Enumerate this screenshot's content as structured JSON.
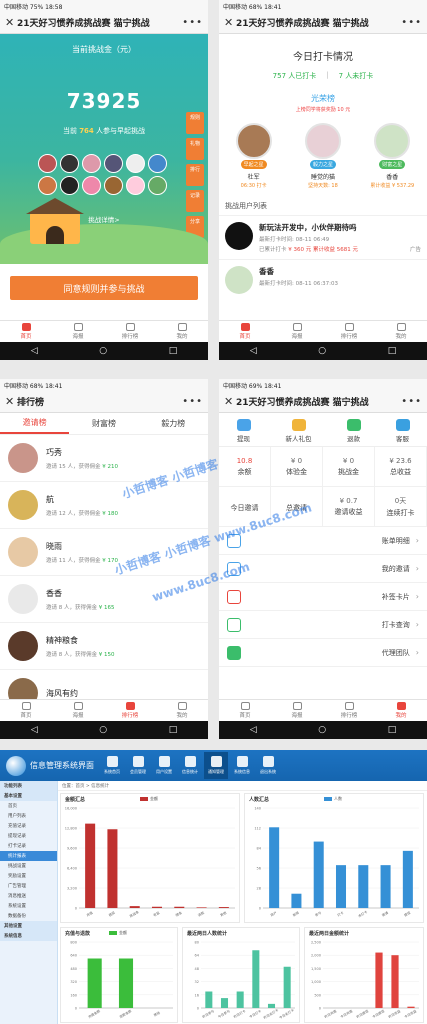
{
  "status": {
    "p1": "中国移动 75% 18:58",
    "p2": "中国移动 68% 18:41",
    "p3": "中国移动 68% 18:41",
    "p4": "中国移动 69% 18:41"
  },
  "p1": {
    "title": "21天好习惯养成挑战赛 猫宁挑战",
    "label": "当前挑战金（元）",
    "amount": "73925",
    "count_pre": "当前",
    "count_num": "764",
    "count_post": "人参与早起挑战",
    "link": "挑战详情>",
    "join": "同意规则并参与挑战",
    "side": [
      "规则",
      "礼物",
      "排行",
      "记录",
      "分享"
    ]
  },
  "p2": {
    "title": "21天好习惯养成挑战赛 猫宁挑战",
    "heading": "今日打卡情况",
    "done": "757 人已打卡",
    "undone": "7 人未打卡",
    "rank_title": "光荣榜",
    "rank_sub": "上榜同学将获奖励 10 元",
    "tops": [
      {
        "tag": "早起之星",
        "name": "杜军",
        "sub": "06:30 打卡"
      },
      {
        "tag": "毅力之星",
        "name": "睡觉的猫",
        "sub": "坚持天数: 18"
      },
      {
        "tag": "财富之星",
        "name": "香香",
        "sub": "累计收益 ¥ 537.29"
      }
    ],
    "list_title": "挑战用户列表",
    "users": [
      {
        "name": "新玩法开发中，小伙伴期待吗",
        "l1": "最新打卡时间: 08-11 06:49",
        "l2a": "已累计打卡",
        "l2b": "¥ 360 元 累计收益",
        "l2c": "5681 元",
        "ad": "广告"
      },
      {
        "name": "香香",
        "l1": "最新打卡时间: 08-11 06:37:03",
        "l2a": "",
        "l2b": "",
        "l2c": "",
        "ad": ""
      }
    ]
  },
  "p3": {
    "title": "排行榜",
    "tabs": [
      "邀请榜",
      "财富榜",
      "毅力榜"
    ],
    "rows": [
      {
        "name": "巧秀",
        "pre": "邀请 15 人，获得佣金",
        "amt": "¥ 210"
      },
      {
        "name": "航",
        "pre": "邀请 12 人，获得佣金",
        "amt": "¥ 180"
      },
      {
        "name": "晓雨",
        "pre": "邀请 11 人，获得佣金",
        "amt": "¥ 170"
      },
      {
        "name": "香香",
        "pre": "邀请 8 人，获得佣金",
        "amt": "¥ 165"
      },
      {
        "name": "精神粮食",
        "pre": "邀请 8 人，获得佣金",
        "amt": "¥ 150"
      },
      {
        "name": "海风有约",
        "pre": "",
        "amt": ""
      }
    ]
  },
  "p4": {
    "title": "21天好习惯养成挑战赛 猫宁挑战",
    "icons": [
      "提现",
      "新人礼包",
      "退款",
      "客服"
    ],
    "cells": [
      {
        "v": "10.8",
        "l": "余额"
      },
      {
        "v": "¥ 0",
        "l": "体验金"
      },
      {
        "v": "¥ 0",
        "l": "挑战金"
      },
      {
        "v": "¥ 23.6",
        "l": "总收益"
      },
      {
        "v": "",
        "l": "今日邀请"
      },
      {
        "v": "",
        "l": "总邀请"
      },
      {
        "v": "¥ 0.7",
        "l": "邀请收益"
      },
      {
        "v": "0天",
        "l": "连续打卡"
      }
    ],
    "menu": [
      "账单明细",
      "我的邀请",
      "补签卡片",
      "打卡查询",
      "代理团队"
    ]
  },
  "tabbar": [
    "首页",
    "海报",
    "排行榜",
    "我的"
  ],
  "watermark": [
    "小哲博客 小哲博客",
    "小哲博客 小哲博客 www.8uc8.com",
    "www.8uc8.com"
  ],
  "admin": {
    "title": "信息管理系统界面",
    "nav": [
      "系统首页",
      "会员管理",
      "用户设置",
      "信息统计",
      "通知管理",
      "系统信息",
      "退出系统"
    ],
    "side": [
      {
        "t": "功能列表",
        "k": "hd"
      },
      {
        "t": "基本设置",
        "k": "hd"
      },
      {
        "t": "首页",
        "k": ""
      },
      {
        "t": "用户列表",
        "k": ""
      },
      {
        "t": "充值记录",
        "k": ""
      },
      {
        "t": "提现记录",
        "k": ""
      },
      {
        "t": "打卡记录",
        "k": ""
      },
      {
        "t": "统计报表",
        "k": "on"
      },
      {
        "t": "挑战设置",
        "k": ""
      },
      {
        "t": "奖励设置",
        "k": ""
      },
      {
        "t": "广告管理",
        "k": ""
      },
      {
        "t": "消息推送",
        "k": ""
      },
      {
        "t": "系统设置",
        "k": ""
      },
      {
        "t": "数据备份",
        "k": ""
      },
      {
        "t": "其他设置",
        "k": "hd"
      },
      {
        "t": "系统信息",
        "k": "hd"
      }
    ],
    "crumb": "位置：首页 > 信息统计"
  },
  "chart_data": [
    {
      "type": "bar",
      "title": "金额汇总",
      "legend": "金额",
      "color": "#c0312f",
      "categories": [
        "充值",
        "提现",
        "挑战金",
        "收益",
        "佣金",
        "退款",
        "其他"
      ],
      "values": [
        13500,
        12600,
        300,
        200,
        200,
        100,
        150
      ],
      "ylim": [
        0,
        16000
      ]
    },
    {
      "type": "bar",
      "title": "人数汇总",
      "legend": "人数",
      "color": "#3590d6",
      "categories": [
        "用户",
        "新增",
        "参与",
        "打卡",
        "未打卡",
        "邀请",
        "提现"
      ],
      "values": [
        113,
        20,
        93,
        60,
        60,
        60,
        80
      ],
      "ylim": [
        0,
        140
      ]
    },
    {
      "type": "bar",
      "title": "充值与退款",
      "legend": "金额",
      "color": "#3bbd3b",
      "categories": [
        "充值金额",
        "退款金额",
        "其他"
      ],
      "values": [
        600,
        600,
        0
      ],
      "ylim": [
        0,
        800
      ]
    },
    {
      "type": "bar",
      "title": "最近两日人数统计",
      "legend": "",
      "color": "#4dc3a0",
      "categories": [
        "昨日参与",
        "今日参与",
        "昨日打卡",
        "今日打卡",
        "昨日未打卡",
        "今日未打卡"
      ],
      "values": [
        20,
        12,
        20,
        70,
        5,
        50
      ],
      "ylim": [
        0,
        80
      ]
    },
    {
      "type": "bar",
      "title": "最近两日金额统计",
      "legend": "",
      "color": "#e0443e",
      "categories": [
        "昨日充值",
        "今日充值",
        "昨日提现",
        "今日提现",
        "昨日收益",
        "今日收益"
      ],
      "values": [
        0,
        0,
        0,
        2100,
        2000,
        50
      ],
      "ylim": [
        0,
        2500
      ]
    }
  ]
}
